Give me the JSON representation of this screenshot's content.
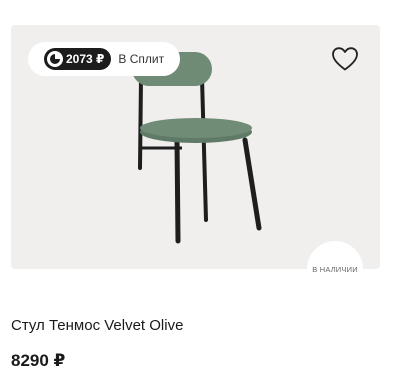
{
  "split": {
    "amount": "2073 ₽",
    "label": "В Сплит"
  },
  "stock": {
    "label": "В НАЛИЧИИ"
  },
  "product": {
    "name": "Стул Тенмос Velvet Olive",
    "price": "8290 ₽"
  },
  "colors": {
    "image_background": "#f0efed",
    "upholstery": "#6f8a75",
    "frame": "#1e1e1e"
  },
  "icons": {
    "favorite": "heart-outline-icon",
    "split_logo": "split-logo-icon"
  }
}
